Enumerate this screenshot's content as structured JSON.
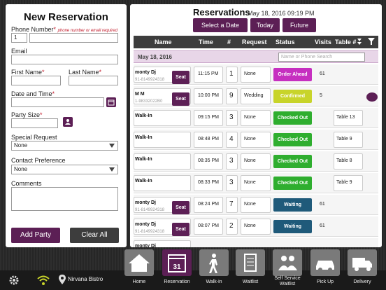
{
  "form": {
    "title": "New Reservation",
    "phone_label": "Phone Number",
    "phone_required_hint": "phone number or email required",
    "country_code": "1",
    "email_label": "Email",
    "first_name_label": "First Name",
    "last_name_label": "Last Name",
    "date_time_label": "Date and Time",
    "party_size_label": "Party Size",
    "special_request_label": "Special Request",
    "special_request_value": "None",
    "contact_pref_label": "Contact Preference",
    "contact_pref_value": "None",
    "comments_label": "Comments",
    "add_button": "Add Party",
    "clear_button": "Clear All",
    "required_mark": "*"
  },
  "reservations": {
    "title": "Reservations",
    "datetime": "May 18, 2016 09:19 PM",
    "btn_select_date": "Select a Date",
    "btn_today": "Today",
    "btn_future": "Future",
    "columns": [
      "Name",
      "Time",
      "#",
      "Request",
      "Status",
      "Visits",
      "Table #"
    ],
    "date_group": "May 18, 2016",
    "search_placeholder": "Name or Phone Search",
    "rows": [
      {
        "name": "monty Dj",
        "phone": "91-8149924318",
        "seat": "Seat",
        "time": "11:15 PM",
        "count": "1",
        "request": "None",
        "status": "Order Ahead",
        "visits": "61",
        "table": ""
      },
      {
        "name": "M M",
        "phone": "1-98332022B0",
        "seat": "Seat",
        "time": "10:00 PM",
        "count": "9",
        "request": "Wedding",
        "status": "Confirmed",
        "visits": "5",
        "table": ""
      },
      {
        "name": "Walk-In",
        "phone": "",
        "seat": "",
        "time": "09:15 PM",
        "count": "3",
        "request": "None",
        "status": "Checked Out",
        "visits": "",
        "table": "Table 13"
      },
      {
        "name": "Walk-In",
        "phone": "",
        "seat": "",
        "time": "08:48 PM",
        "count": "4",
        "request": "None",
        "status": "Checked Out",
        "visits": "",
        "table": "Table 9"
      },
      {
        "name": "Walk-In",
        "phone": "",
        "seat": "",
        "time": "08:35 PM",
        "count": "3",
        "request": "None",
        "status": "Checked Out",
        "visits": "",
        "table": "Table 8"
      },
      {
        "name": "Walk-In",
        "phone": "",
        "seat": "",
        "time": "08:33 PM",
        "count": "3",
        "request": "None",
        "status": "Checked Out",
        "visits": "",
        "table": "Table 9"
      },
      {
        "name": "monty Dj",
        "phone": "91-8149924318",
        "seat": "Seat",
        "time": "08:24 PM",
        "count": "7",
        "request": "None",
        "status": "Waiting",
        "visits": "61",
        "table": ""
      },
      {
        "name": "monty Dj",
        "phone": "91-8149924318",
        "seat": "Seat",
        "time": "08:07 PM",
        "count": "2",
        "request": "None",
        "status": "Waiting",
        "visits": "61",
        "table": ""
      },
      {
        "name": "monty Dj",
        "phone": "",
        "seat": "",
        "time": "",
        "count": "",
        "request": "",
        "status": "",
        "visits": "",
        "table": ""
      }
    ]
  },
  "status_colors": {
    "Order Ahead": "#c62fc0",
    "Confirmed": "#c8d42a",
    "Checked Out": "#2fae2f",
    "Waiting": "#1f5a7a"
  },
  "nav": {
    "items": [
      "Home",
      "Reservation",
      "Walk-in",
      "Waitlist",
      "Self Service Waitlist",
      "Pick Up",
      "Delivery"
    ],
    "icons": [
      "home-icon",
      "calendar-icon",
      "walk-icon",
      "list-icon",
      "people-icon",
      "car-icon",
      "truck-icon"
    ],
    "calendar_day": "31",
    "location": "Nirvana Bistro"
  }
}
